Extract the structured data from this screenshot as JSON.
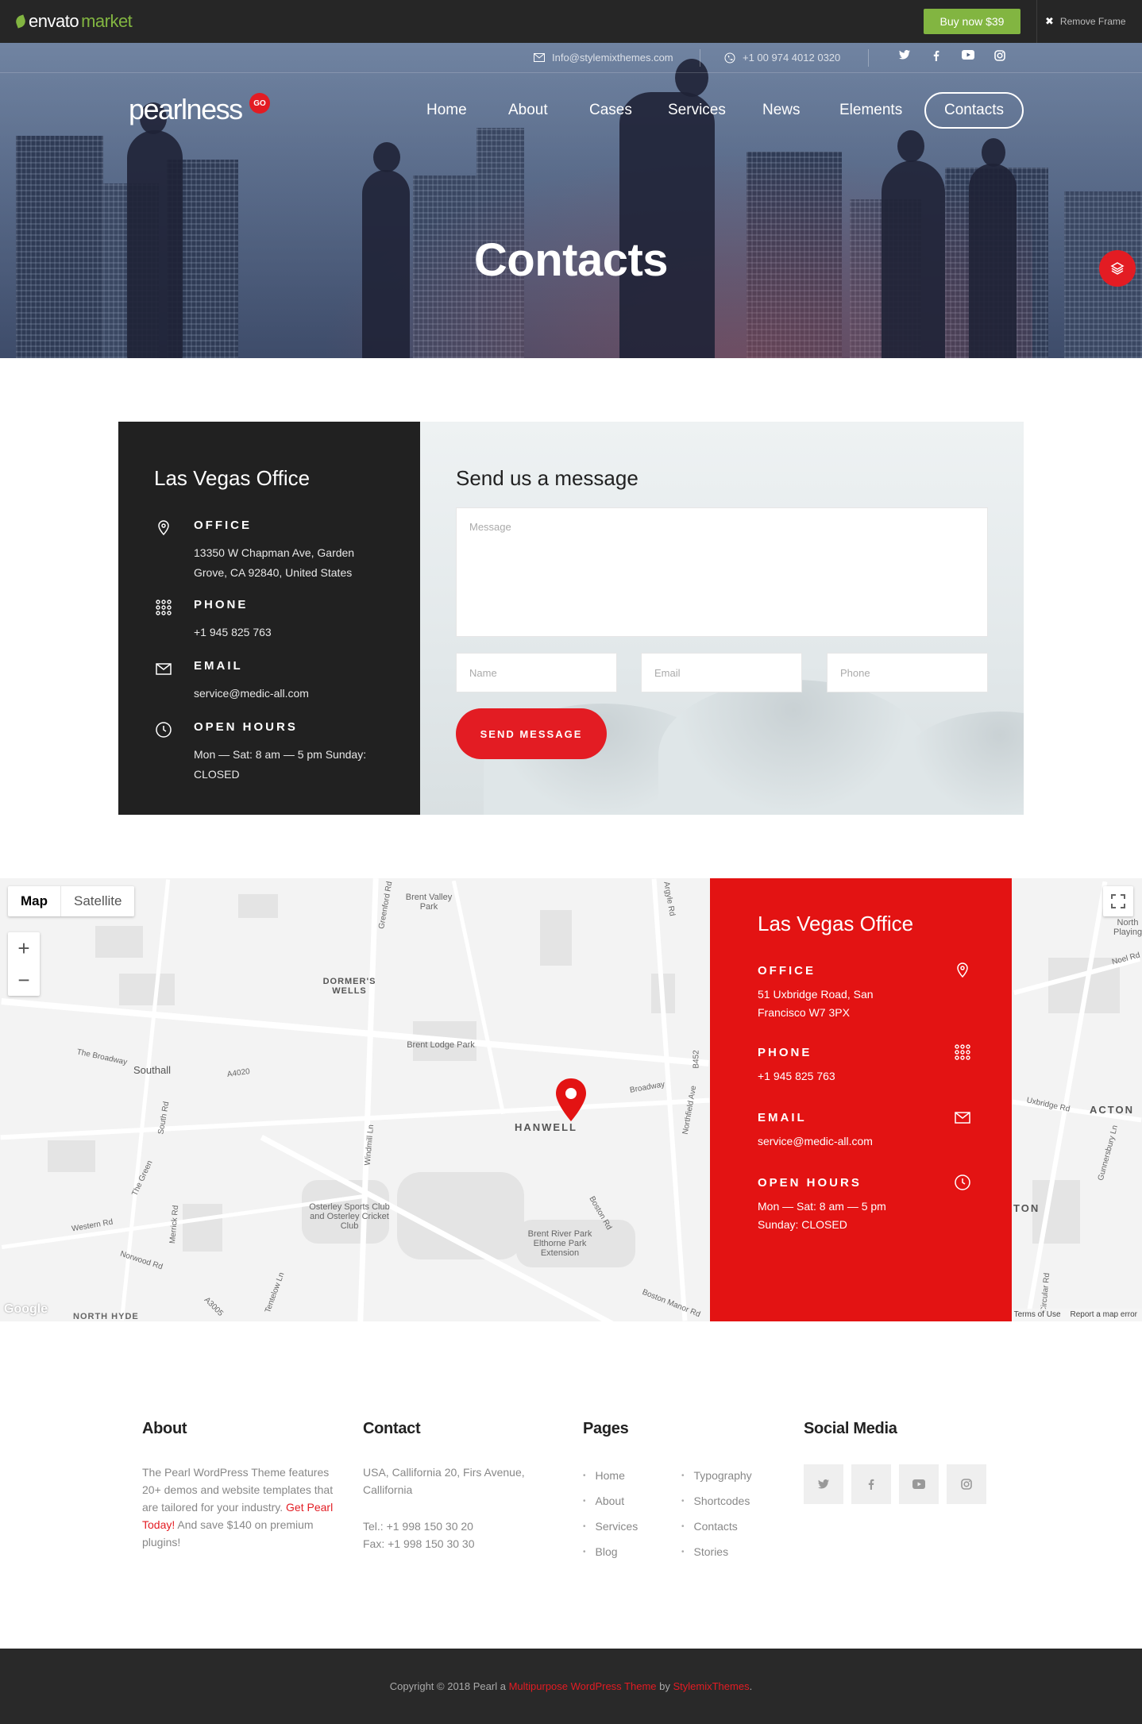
{
  "envato": {
    "logo_a": "envato",
    "logo_b": "market",
    "buy": "Buy now $39",
    "remove": "Remove Frame"
  },
  "topbar": {
    "email": "Info@stylemixthemes.com",
    "phone": "+1 00 974 4012 0320"
  },
  "brand": {
    "name": "pearlness",
    "badge": "GO"
  },
  "nav": {
    "items": [
      "Home",
      "About",
      "Cases",
      "Services",
      "News",
      "Elements"
    ],
    "active": "Contacts"
  },
  "hero": {
    "title": "Contacts"
  },
  "office": {
    "title": "Las Vegas Office",
    "office_label": "OFFICE",
    "office_value": "13350 W Chapman Ave, Garden Grove, CA 92840, United States",
    "phone_label": "PHONE",
    "phone_value": "+1 945 825 763",
    "email_label": "EMAIL",
    "email_value": "service@medic-all.com",
    "hours_label": "OPEN HOURS",
    "hours_value": "Mon — Sat: 8 am — 5 pm Sunday: CLOSED"
  },
  "form": {
    "title": "Send us a message",
    "message_ph": "Message",
    "name_ph": "Name",
    "email_ph": "Email",
    "phone_ph": "Phone",
    "submit": "SEND MESSAGE"
  },
  "map": {
    "type_map": "Map",
    "type_sat": "Satellite",
    "labels": [
      "Brent Valley Park",
      "DORMER'S WELLS",
      "Brent Lodge Park",
      "Southall",
      "HANWELL",
      "Osterley Sports Club and Osterley Cricket Club",
      "Brent River Park Elthorne Park Extension",
      "NORTH HYDE",
      "ACTON",
      "Broadway",
      "The Broadway",
      "A4020",
      "B452",
      "Northfield Ave",
      "Boston Rd",
      "Uxbridge Rd",
      "Greenford Rd",
      "Argyle Rd",
      "Windmill Ln",
      "South Rd",
      "The Green",
      "Merrick Rd",
      "Norwood Rd",
      "Western Rd",
      "Tentelow Ln",
      "Boston Manor Rd",
      "Noel Rd",
      "Gunnersbury Ln",
      "North Playing",
      "TON",
      "A3005",
      "Circular Rd"
    ],
    "google": "Google",
    "terms": "Terms of Use",
    "report": "Report a map error"
  },
  "mapbox": {
    "title": "Las Vegas Office",
    "office_label": "OFFICE",
    "office_value": "51 Uxbridge Road, San Francisco W7 3PX",
    "phone_label": "PHONE",
    "phone_value": "+1 945 825 763",
    "email_label": "EMAIL",
    "email_value": "service@medic-all.com",
    "hours_label": "OPEN HOURS",
    "hours_value": "Mon — Sat: 8 am — 5 pm Sunday: CLOSED"
  },
  "footer": {
    "about_title": "About",
    "about_text": "The Pearl WordPress Theme features 20+ demos and website templates that are tailored for your industry.",
    "about_link": "Get Pearl Today!",
    "about_text2": "And save $140 on premium plugins!",
    "contact_title": "Contact",
    "contact_addr": "USA, Callifornia 20, Firs Avenue, Callifornia",
    "contact_tel": "Tel.: +1 998 150 30 20",
    "contact_fax": "Fax: +1 998 150 30 30",
    "pages_title": "Pages",
    "pages_a": [
      "Home",
      "About",
      "Services",
      "Blog"
    ],
    "pages_b": [
      "Typography",
      "Shortcodes",
      "Contacts",
      "Stories"
    ],
    "social_title": "Social Media"
  },
  "copyright": {
    "pre": "Copyright © 2018 Pearl a",
    "link1": "Multipurpose WordPress Theme",
    "mid": "by",
    "link2": "StylemixThemes",
    "end": "."
  },
  "colors": {
    "accent": "#e31c23",
    "envato_green": "#82b541",
    "dark": "#212121",
    "map_red": "#e31313"
  }
}
